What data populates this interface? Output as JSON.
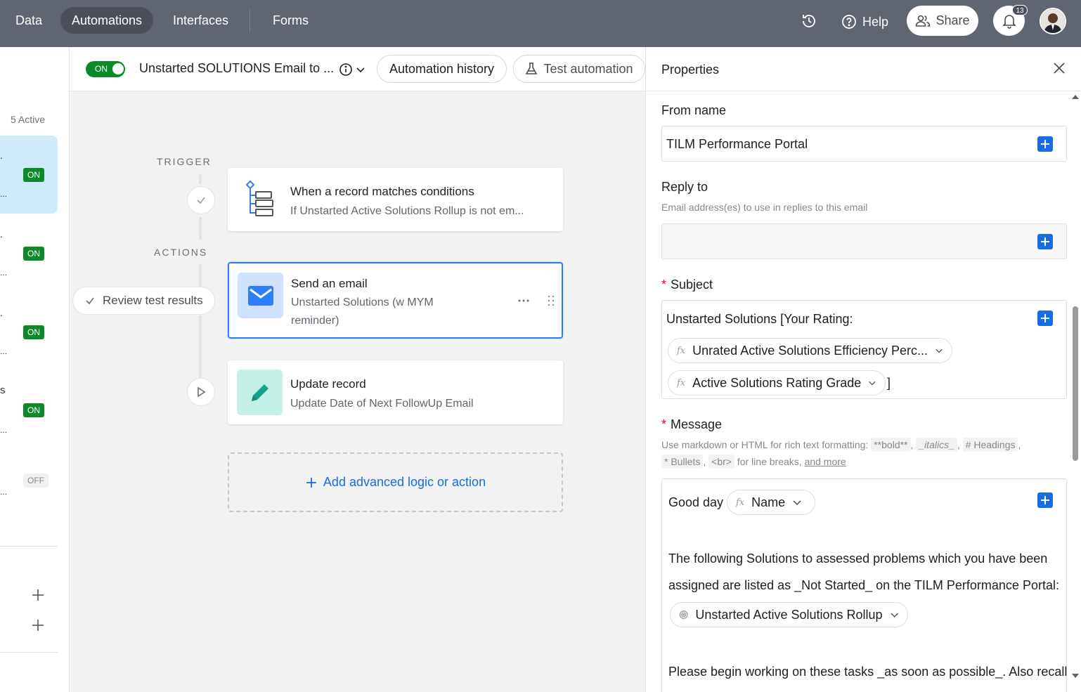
{
  "nav": {
    "data": "Data",
    "automations": "Automations",
    "interfaces": "Interfaces",
    "forms": "Forms",
    "help": "Help",
    "share": "Share",
    "notifications_count": "13"
  },
  "left_list": {
    "active_count": "5 Active",
    "items": [
      {
        "status": "ON",
        "selected": true
      },
      {
        "status": "ON"
      },
      {
        "status": "ON"
      },
      {
        "status": "ON",
        "letter": "s"
      },
      {
        "status": "OFF"
      }
    ]
  },
  "header": {
    "toggle": "ON",
    "title": "Unstarted SOLUTIONS Email to ...",
    "history_btn": "Automation history",
    "test_btn": "Test automation"
  },
  "canvas": {
    "trigger_label": "TRIGGER",
    "actions_label": "ACTIONS",
    "trigger_card": {
      "title": "When a record matches conditions",
      "subtitle": "If Unstarted Active Solutions Rollup is not em..."
    },
    "review_btn": "Review test results",
    "email_card": {
      "title": "Send an email",
      "subtitle_1": "Unstarted Solutions (w MYM",
      "subtitle_2": "reminder)"
    },
    "update_card": {
      "title": "Update record",
      "subtitle": "Update Date of Next FollowUp Email"
    },
    "add_action": "Add advanced logic or action"
  },
  "properties": {
    "title": "Properties",
    "from_name_label": "From name",
    "from_name_value": "TILM Performance Portal",
    "reply_to_label": "Reply to",
    "reply_to_help": "Email address(es) to use in replies to this email",
    "subject_label": "Subject",
    "subject_text": "Unstarted Solutions [Your Rating:",
    "subject_token_1": "Unrated Active Solutions Efficiency Perc...",
    "subject_token_2": "Active Solutions Rating Grade",
    "subject_tail": "]",
    "message_label": "Message",
    "message_help_1": "Use markdown or HTML for rich text formatting:",
    "chip_bold": "**bold**",
    "chip_italics": "_italics_",
    "chip_headings": "# Headings",
    "chip_bullets": "* Bullets",
    "chip_br": "<br>",
    "message_help_2": "for line breaks,",
    "message_help_link": "and more",
    "message_greeting": "Good day",
    "message_token_name": "Name",
    "message_line_1": "The following Solutions to assessed problems which you have been",
    "message_line_2": "assigned are listed as _Not Started_ on the TILM Performance Portal:",
    "message_token_rollup": "Unstarted Active Solutions Rollup",
    "message_line_3": "Please begin working on these tasks _as soon as possible_. Also recall"
  },
  "colors": {
    "topbar": "#606572",
    "on_green": "#0c8a29",
    "accent_blue": "#166ee1",
    "selected_blue": "#2d7ff9",
    "list_selected": "#cfeafb"
  }
}
